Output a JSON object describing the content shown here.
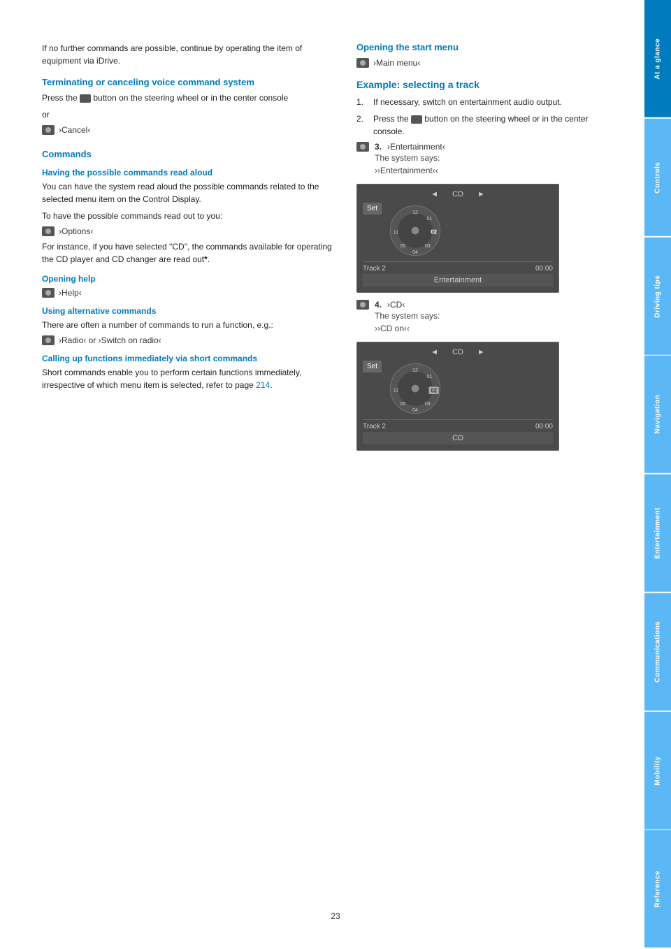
{
  "page": {
    "number": "23",
    "intro_text": "If no further commands are possible, continue by operating the item of equipment via iDrive."
  },
  "sidebar": {
    "tabs": [
      {
        "id": "at-a-glance",
        "label": "At a glance",
        "active": true
      },
      {
        "id": "controls",
        "label": "Controls",
        "active": false
      },
      {
        "id": "driving-tips",
        "label": "Driving tips",
        "active": false
      },
      {
        "id": "navigation",
        "label": "Navigation",
        "active": false
      },
      {
        "id": "entertainment",
        "label": "Entertainment",
        "active": false
      },
      {
        "id": "communications",
        "label": "Communications",
        "active": false
      },
      {
        "id": "mobility",
        "label": "Mobility",
        "active": false
      },
      {
        "id": "reference",
        "label": "Reference",
        "active": false
      }
    ]
  },
  "left_column": {
    "terminating_section": {
      "heading": "Terminating or canceling voice command system",
      "body": "Press the",
      "body2": "button on the steering wheel or in the center console",
      "or_text": "or",
      "cancel_cmd": "›Cancel‹"
    },
    "commands_section": {
      "heading": "Commands"
    },
    "having_commands_section": {
      "subheading": "Having the possible commands read aloud",
      "body1": "You can have the system read aloud the possible commands related to the selected menu item on the Control Display.",
      "body2": "To have the possible commands read out to you:",
      "cmd": "›Options‹",
      "body3": "For instance, if you have selected \"CD\", the commands available for operating the CD player and CD changer are read out",
      "asterisk": "*",
      "period": "."
    },
    "opening_help_section": {
      "subheading": "Opening help",
      "cmd": "›Help‹"
    },
    "using_alternative_section": {
      "subheading": "Using alternative commands",
      "body": "There are often a number of commands to run a function, e.g.:",
      "cmd": "›Radio‹ or ›Switch on radio‹"
    },
    "calling_up_section": {
      "subheading": "Calling up functions immediately via short commands",
      "body1": "Short commands enable you to perform certain functions immediately, irrespective of which menu item is selected, refer to page",
      "link_text": "214",
      "period": "."
    }
  },
  "right_column": {
    "opening_start_menu": {
      "heading": "Opening the start menu",
      "cmd": "›Main menu‹"
    },
    "example_section": {
      "heading": "Example: selecting a track",
      "steps": [
        {
          "number": "1.",
          "text": "If necessary, switch on entertainment audio output."
        },
        {
          "number": "2.",
          "text": "Press the",
          "text2": "button on the steering wheel or in the center console."
        }
      ],
      "step3": {
        "number": "3.",
        "cmd": "›Entertainment‹",
        "says_label": "The system says:",
        "says_text": "››Entertainment‹‹"
      },
      "display1": {
        "nav_left": "◄",
        "nav_label": "CD",
        "nav_right": "►",
        "set_label": "Set",
        "track_label": "Track 2",
        "time": "00:00",
        "bottom_label": "Entertainment",
        "disc_numbers": [
          "11",
          "12",
          "01",
          "02",
          "03",
          "04",
          "05"
        ]
      },
      "step4": {
        "number": "4.",
        "cmd": "›CD‹",
        "says_label": "The system says:",
        "says_text": "››CD on‹‹"
      },
      "display2": {
        "nav_left": "◄",
        "nav_label": "CD",
        "nav_right": "►",
        "set_label": "Set",
        "track_label": "Track 2",
        "time": "00:00",
        "bottom_label": "CD",
        "disc_numbers": [
          "11",
          "12",
          "01",
          "02",
          "03",
          "04",
          "05"
        ],
        "active_number": "02"
      }
    }
  }
}
